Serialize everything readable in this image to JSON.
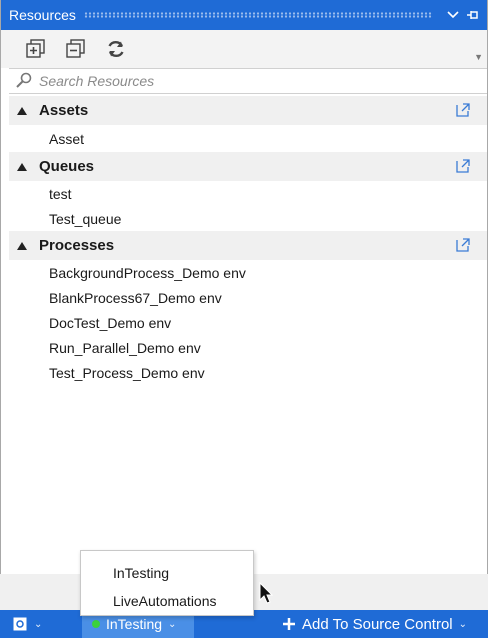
{
  "panel": {
    "title": "Resources",
    "colors": {
      "accent": "#1f6bd6",
      "env_bg": "#4a8fe6",
      "status_dot": "#3bd13b"
    },
    "toolbar": [
      "expand-all-icon",
      "collapse-all-icon",
      "refresh-icon"
    ],
    "search": {
      "placeholder": "Search Resources",
      "value": ""
    }
  },
  "tree": [
    {
      "label": "Assets",
      "items": [
        "Asset"
      ]
    },
    {
      "label": "Queues",
      "items": [
        "test",
        "Test_queue"
      ]
    },
    {
      "label": "Processes",
      "items": [
        "BackgroundProcess_Demo env",
        "BlankProcess67_Demo env",
        "DocTest_Demo env",
        "Run_Parallel_Demo env",
        "Test_Process_Demo env"
      ]
    }
  ],
  "popup": {
    "options": [
      "InTesting",
      "LiveAutomations"
    ]
  },
  "statusbar": {
    "environment": "InTesting",
    "source_control": "Add To Source Control"
  }
}
